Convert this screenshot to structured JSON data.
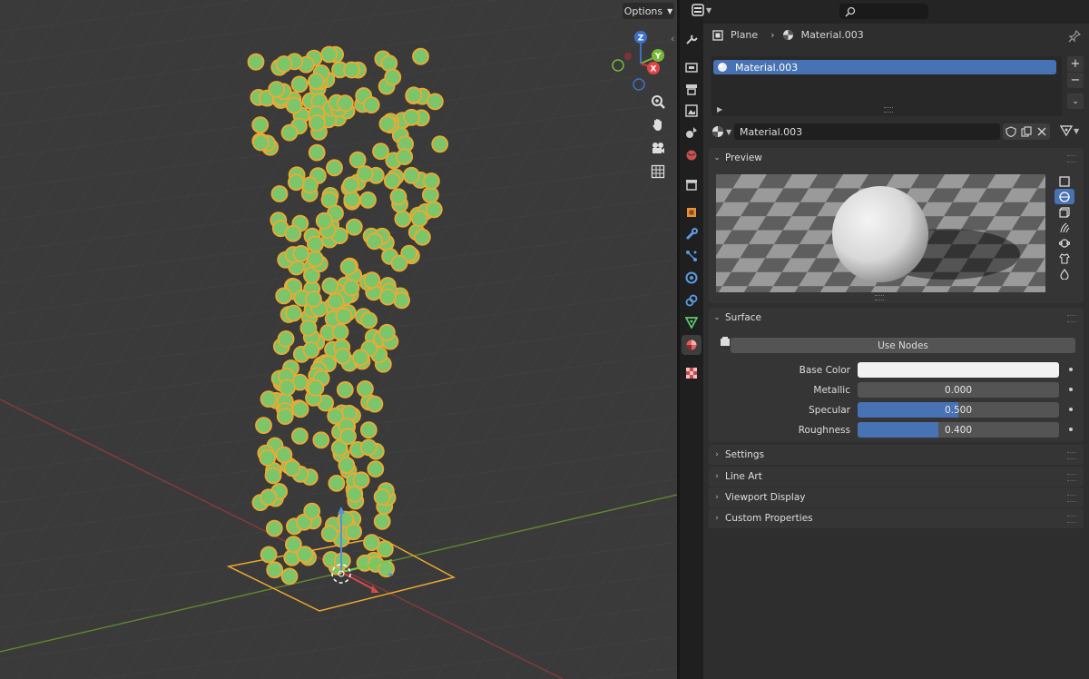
{
  "viewport": {
    "options_label": "Options",
    "gizmo_axes": {
      "z": "Z",
      "y": "Y",
      "x": "X"
    },
    "tools": [
      "zoom-icon",
      "hand-pan-icon",
      "camera-icon",
      "grid-toggle-icon"
    ]
  },
  "properties": {
    "breadcrumb": {
      "object": "Plane",
      "material": "Material.003"
    },
    "material_slots": [
      {
        "name": "Material.003",
        "selected": true
      }
    ],
    "material_name": "Material.003",
    "preview": {
      "title": "Preview"
    },
    "surface": {
      "title": "Surface",
      "use_nodes_label": "Use Nodes",
      "fields": [
        {
          "label": "Base Color",
          "value": "",
          "color": "#f2f2f2"
        },
        {
          "label": "Metallic",
          "value": "0.000",
          "fraction": 0.0
        },
        {
          "label": "Specular",
          "value": "0.500",
          "fraction": 0.5
        },
        {
          "label": "Roughness",
          "value": "0.400",
          "fraction": 0.4
        }
      ]
    },
    "collapsed_panels": [
      "Settings",
      "Line Art",
      "Viewport Display",
      "Custom Properties"
    ]
  },
  "colors": {
    "accent": "#4772b3",
    "selection_outline": "#f0a830",
    "particle_fill": "#7bc66a"
  }
}
